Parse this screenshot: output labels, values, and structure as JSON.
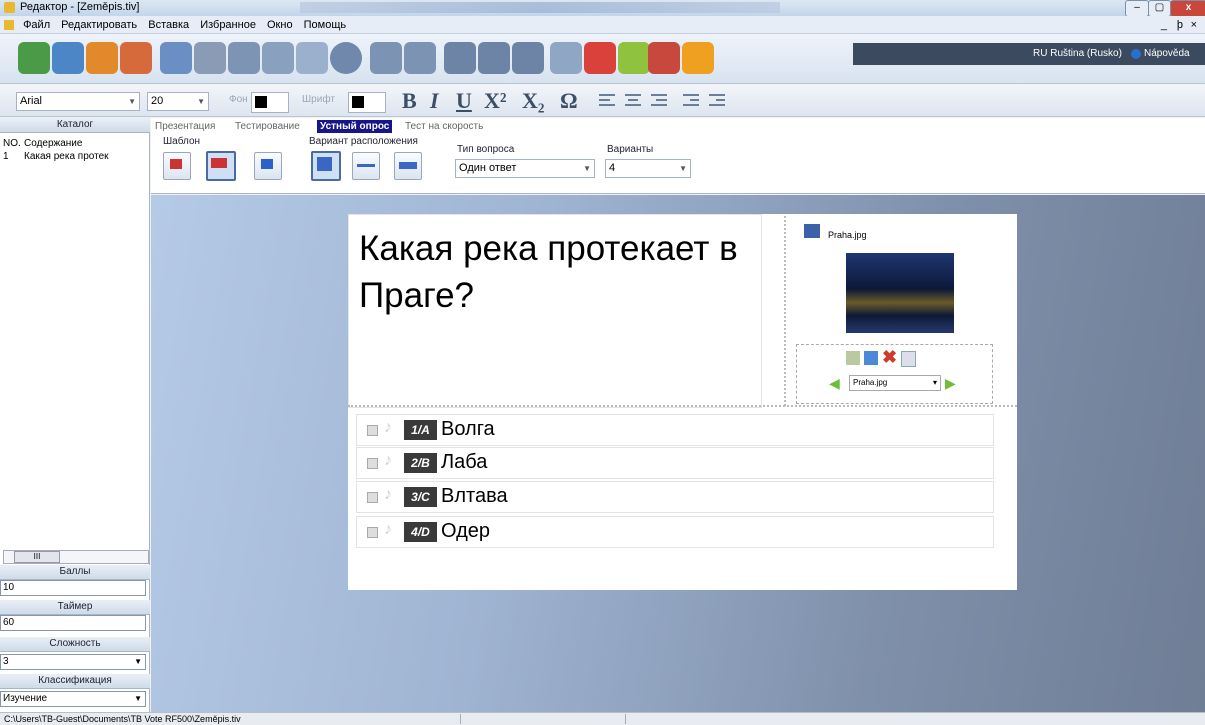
{
  "window": {
    "title": "Редактор - [Zeměpis.tiv]",
    "min": "–",
    "max": "▢",
    "close": "x"
  },
  "menu": [
    "Файл",
    "Редактировать",
    "Вставка",
    "Избранное",
    "Окно",
    "Помощь"
  ],
  "mdi_controls": [
    "_",
    "ϸ",
    "×"
  ],
  "toolbar": {
    "lang": "RU Ruština (Rusko)",
    "help": "Nápověda"
  },
  "format": {
    "font": "Arial",
    "size": "20",
    "font_label": "Фон",
    "font_color_label": "Шрифт",
    "bold": "B",
    "italic": "I",
    "underline": "U",
    "super": "X²",
    "sub": "X₂",
    "omega": "Ω"
  },
  "left": {
    "catalog_header": "Каталог",
    "col_no": "NO.",
    "col_content": "Содержание",
    "rows": [
      {
        "no": "1",
        "content": "Какая река протек"
      }
    ],
    "scroll_mark": "III",
    "points_label": "Баллы",
    "points": "10",
    "timer_label": "Таймер",
    "timer": "60",
    "difficulty_label": "Сложность",
    "difficulty": "3",
    "classification_label": "Классификация",
    "classification": "Изучение"
  },
  "tabs": [
    "Презентация",
    "Тестирование",
    "Устный опрос",
    "Тест на скорость"
  ],
  "options": {
    "template_label": "Шаблон",
    "layout_label": "Вариант расположения",
    "qtype_label": "Тип вопроса",
    "qtype": "Один ответ",
    "variants_label": "Варианты",
    "variants": "4"
  },
  "slide": {
    "question": "Какая река протекает в Праге?",
    "image_name": "Praha.jpg",
    "image_select": "Praha.jpg",
    "answers": [
      {
        "badge": "1/A",
        "text": "Волга"
      },
      {
        "badge": "2/B",
        "text": "Лаба"
      },
      {
        "badge": "3/C",
        "text": "Влтава"
      },
      {
        "badge": "4/D",
        "text": "Одер"
      }
    ]
  },
  "status": {
    "path": "C:\\Users\\TB-Guest\\Documents\\TB Vote RF500\\Zeměpis.tiv"
  }
}
